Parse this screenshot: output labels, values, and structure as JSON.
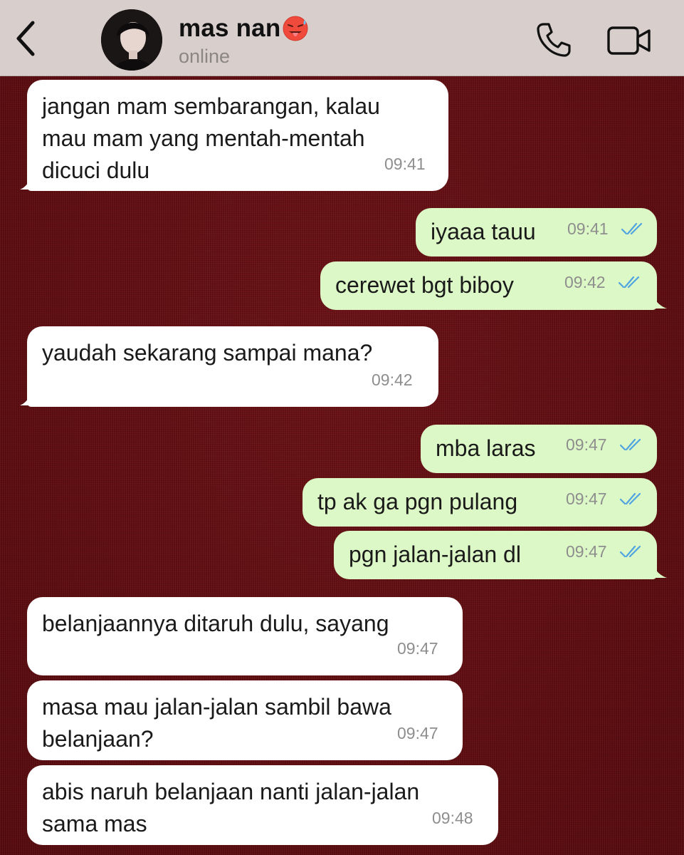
{
  "header": {
    "contact_name": "mas nan",
    "status": "online",
    "icons": {
      "back": "chevron-left-icon",
      "call": "phone-icon",
      "video": "video-camera-icon",
      "emoji": "hot-face-emoji"
    }
  },
  "messages": [
    {
      "dir": "in",
      "text": "jangan mam sembarangan, kalau\nmau mam yang mentah-mentah\ndicuci dulu",
      "time": "09:41"
    },
    {
      "dir": "out",
      "text": "iyaaa tauu",
      "time": "09:41",
      "read": true
    },
    {
      "dir": "out",
      "text": "cerewet bgt biboy",
      "time": "09:42",
      "read": true
    },
    {
      "dir": "in",
      "text": "yaudah sekarang sampai mana?",
      "time": "09:42"
    },
    {
      "dir": "out",
      "text": "mba laras",
      "time": "09:47",
      "read": true
    },
    {
      "dir": "out",
      "text": "tp ak ga pgn pulang",
      "time": "09:47",
      "read": true
    },
    {
      "dir": "out",
      "text": "pgn jalan-jalan dl",
      "time": "09:47",
      "read": true
    },
    {
      "dir": "in",
      "text": "belanjaannya ditaruh dulu, sayang",
      "time": "09:47"
    },
    {
      "dir": "in",
      "text": "masa mau jalan-jalan sambil bawa\nbelanjaan?",
      "time": "09:47"
    },
    {
      "dir": "in",
      "text": "abis naruh belanjaan nanti jalan-jalan\nsama mas",
      "time": "09:48"
    }
  ],
  "colors": {
    "header_bg": "#d8cfcc",
    "chat_bg": "#5e0d10",
    "incoming_bubble": "#ffffff",
    "outgoing_bubble": "#dcf8c6",
    "read_ticks": "#4fa3e0",
    "timestamp": "#8e8e8e"
  }
}
